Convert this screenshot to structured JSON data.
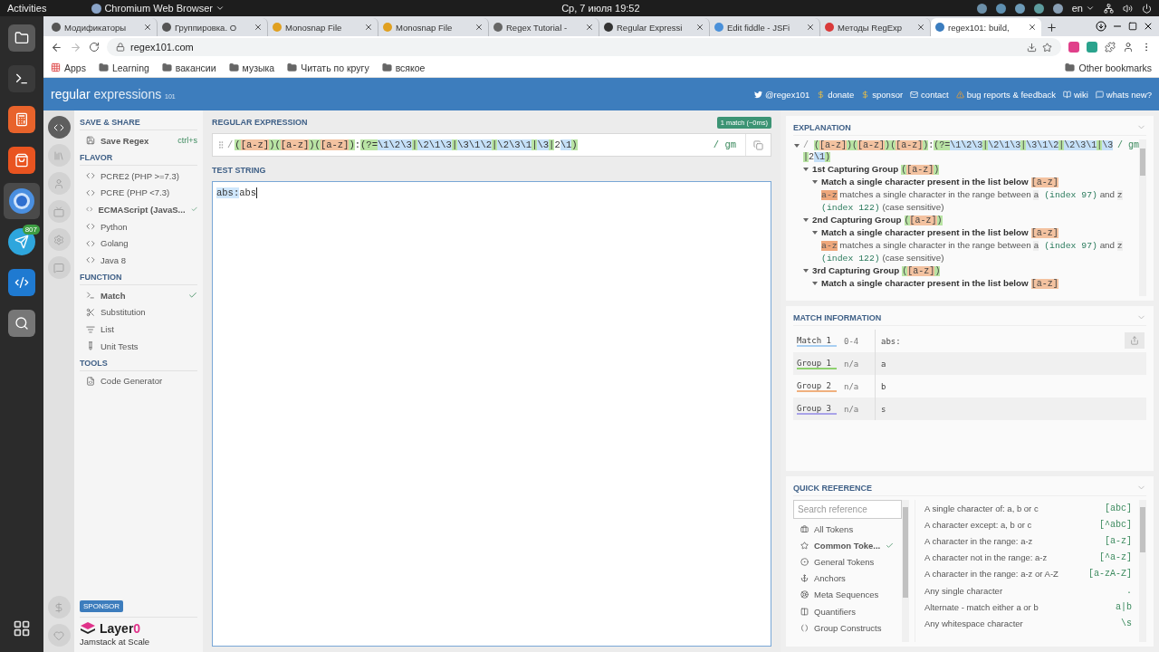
{
  "topbar": {
    "activities": "Activities",
    "app": "Chromium Web Browser",
    "clock": "Ср, 7 июля  19:52",
    "language": "en"
  },
  "dock": [
    {
      "kind": "files",
      "selected": false
    },
    {
      "kind": "terminal",
      "selected": false
    },
    {
      "kind": "calculator",
      "selected": false
    },
    {
      "kind": "store",
      "selected": false
    },
    {
      "kind": "chromium",
      "selected": true
    },
    {
      "kind": "telegram",
      "selected": false,
      "badge": "807"
    },
    {
      "kind": "vscode",
      "selected": false
    },
    {
      "kind": "screenshot",
      "selected": false
    }
  ],
  "browser": {
    "tabs": [
      {
        "title": "Модификаторы",
        "color": "#555555",
        "selected": false
      },
      {
        "title": "Группировка. О",
        "color": "#555555",
        "selected": false
      },
      {
        "title": "Monosnap File",
        "color": "#e0a020",
        "selected": false
      },
      {
        "title": "Monosnap File",
        "color": "#e0a020",
        "selected": false
      },
      {
        "title": "Regex Tutorial -",
        "color": "#666666",
        "selected": false
      },
      {
        "title": "Regular Expressi",
        "color": "#333333",
        "selected": false
      },
      {
        "title": "Edit fiddle - JSFi",
        "color": "#4a90d9",
        "selected": false
      },
      {
        "title": "Методы RegExp",
        "color": "#d93a3a",
        "selected": false
      },
      {
        "title": "regex101: build,",
        "color": "#3b7dbf",
        "selected": true
      }
    ],
    "url": "regex101.com",
    "bookmarks": [
      {
        "label": "Apps",
        "kind": "apps"
      },
      {
        "label": "Learning",
        "kind": "folder"
      },
      {
        "label": "вакансии",
        "kind": "folder"
      },
      {
        "label": "музыка",
        "kind": "folder"
      },
      {
        "label": "Читать по кругу",
        "kind": "folder"
      },
      {
        "label": "всякое",
        "kind": "folder"
      }
    ],
    "other_bookmarks": "Other bookmarks"
  },
  "site": {
    "logo": {
      "main": "regular",
      "sub": "expressions",
      "tag": "101"
    },
    "links": [
      {
        "label": "@regex101",
        "kind": "twitter"
      },
      {
        "label": "donate",
        "kind": "dollar"
      },
      {
        "label": "sponsor",
        "kind": "dollar"
      },
      {
        "label": "contact",
        "kind": "mail"
      },
      {
        "label": "bug reports & feedback",
        "kind": "bug"
      },
      {
        "label": "wiki",
        "kind": "wiki"
      },
      {
        "label": "whats new?",
        "kind": "chat"
      }
    ]
  },
  "rail": [
    {
      "kind": "code",
      "selected": true
    },
    {
      "kind": "library",
      "selected": false
    },
    {
      "kind": "user",
      "selected": false
    },
    {
      "kind": "video",
      "selected": false
    },
    {
      "kind": "settings",
      "selected": false
    },
    {
      "kind": "chat",
      "selected": false
    }
  ],
  "rail_bottom": [
    {
      "kind": "dollar"
    },
    {
      "kind": "heart"
    }
  ],
  "sidebar": {
    "sections": [
      {
        "title": "SAVE & SHARE",
        "items": [
          {
            "label": "Save Regex",
            "shortcut": "ctrl+s",
            "kind": "action"
          }
        ]
      },
      {
        "title": "FLAVOR",
        "items": [
          {
            "label": "PCRE2 (PHP >=7.3)",
            "kind": "option",
            "selected": false
          },
          {
            "label": "PCRE (PHP <7.3)",
            "kind": "option",
            "selected": false
          },
          {
            "label": "ECMAScript (JavaS...",
            "kind": "option",
            "selected": true
          },
          {
            "label": "Python",
            "kind": "option",
            "selected": false
          },
          {
            "label": "Golang",
            "kind": "option",
            "selected": false
          },
          {
            "label": "Java 8",
            "kind": "option",
            "selected": false
          }
        ]
      },
      {
        "title": "FUNCTION",
        "items": [
          {
            "label": "Match",
            "kind": "option",
            "selected": true
          },
          {
            "label": "Substitution",
            "kind": "option",
            "selected": false
          },
          {
            "label": "List",
            "kind": "option",
            "selected": false
          },
          {
            "label": "Unit Tests",
            "kind": "option",
            "selected": false
          }
        ]
      },
      {
        "title": "TOOLS",
        "items": [
          {
            "label": "Code Generator",
            "kind": "option",
            "selected": false
          }
        ]
      }
    ],
    "sponsor": {
      "badge": "SPONSOR",
      "brand": "Layer",
      "brand_accent": "0",
      "tagline": "Jamstack at Scale"
    }
  },
  "editor": {
    "regex_label": "REGULAR EXPRESSION",
    "status": "1 match (~0ms)",
    "delimiter": "/",
    "flags": "/ gm",
    "tokens": [
      {
        "text": "(",
        "kind": "group"
      },
      {
        "text": "[a-z]",
        "kind": "class"
      },
      {
        "text": ")",
        "kind": "group"
      },
      {
        "text": "(",
        "kind": "group"
      },
      {
        "text": "[a-z]",
        "kind": "class"
      },
      {
        "text": ")",
        "kind": "group"
      },
      {
        "text": "(",
        "kind": "group"
      },
      {
        "text": "[a-z]",
        "kind": "class"
      },
      {
        "text": ")",
        "kind": "group"
      },
      {
        "text": ":",
        "kind": "plain"
      },
      {
        "text": "(?=",
        "kind": "group"
      },
      {
        "text": "\\1\\2\\3",
        "kind": "backref"
      },
      {
        "text": "|",
        "kind": "group"
      },
      {
        "text": "\\2\\1\\3",
        "kind": "backref"
      },
      {
        "text": "|",
        "kind": "group"
      },
      {
        "text": "\\3\\1\\2",
        "kind": "backref"
      },
      {
        "text": "|",
        "kind": "group"
      },
      {
        "text": "\\2\\3\\1",
        "kind": "backref"
      },
      {
        "text": "|",
        "kind": "group"
      },
      {
        "text": "\\3",
        "kind": "backref"
      },
      {
        "text": "|",
        "kind": "group"
      },
      {
        "text": "2",
        "kind": "plain"
      },
      {
        "text": "\\1",
        "kind": "backref"
      },
      {
        "text": ")",
        "kind": "group"
      }
    ],
    "test_label": "TEST STRING",
    "test": [
      {
        "text": "abs:",
        "matched": true
      },
      {
        "text": "abs",
        "matched": false
      }
    ]
  },
  "explanation": {
    "title": "EXPLANATION",
    "tree": [
      {
        "delimiter": "/",
        "flags": "/ gm",
        "expanded": true,
        "tokens": [
          {
            "text": "(",
            "kind": "group"
          },
          {
            "text": "[a-z]",
            "kind": "class"
          },
          {
            "text": ")",
            "kind": "group"
          },
          {
            "text": "(",
            "kind": "group"
          },
          {
            "text": "[a-z]",
            "kind": "class"
          },
          {
            "text": ")",
            "kind": "group"
          },
          {
            "text": "(",
            "kind": "group"
          },
          {
            "text": "[a-z]",
            "kind": "class"
          },
          {
            "text": ")",
            "kind": "group"
          },
          {
            "text": ":",
            "kind": "plain"
          },
          {
            "text": "(?=",
            "kind": "group"
          },
          {
            "text": "\\1\\2\\3",
            "kind": "backref"
          },
          {
            "text": "|",
            "kind": "group"
          },
          {
            "text": "\\2\\1\\3",
            "kind": "backref"
          },
          {
            "text": "|",
            "kind": "group"
          },
          {
            "text": "\\3\\1\\2",
            "kind": "backref"
          },
          {
            "text": "|",
            "kind": "group"
          },
          {
            "text": "\\2\\3\\1",
            "kind": "backref"
          },
          {
            "text": "|",
            "kind": "group"
          },
          {
            "text": "\\3",
            "kind": "backref"
          },
          {
            "text": "|",
            "kind": "group"
          },
          {
            "text": "2",
            "kind": "plain"
          },
          {
            "text": "\\1",
            "kind": "backref"
          },
          {
            "text": ")",
            "kind": "group"
          }
        ],
        "children": [
          {
            "title": "1st Capturing Group",
            "expanded": true,
            "tokens": [
              {
                "text": "(",
                "kind": "group"
              },
              {
                "text": "[a-z]",
                "kind": "class"
              },
              {
                "text": ")",
                "kind": "group"
              }
            ],
            "children": [
              {
                "title": "Match a single character present in the list below",
                "expanded": true,
                "tokens": [
                  {
                    "text": "[a-z]",
                    "kind": "class"
                  }
                ],
                "detail": [
                  {
                    "text": "a-z",
                    "kind": "class"
                  },
                  {
                    "text": " matches a single character in the range between ",
                    "kind": "plain"
                  },
                  {
                    "text": "a",
                    "kind": "char"
                  },
                  {
                    "text": " (index 97)",
                    "kind": "code"
                  },
                  {
                    "text": " and ",
                    "kind": "plain"
                  },
                  {
                    "text": "z",
                    "kind": "char"
                  },
                  {
                    "text": " (index 122)",
                    "kind": "code"
                  },
                  {
                    "text": " (case sensitive)",
                    "kind": "plain"
                  }
                ]
              }
            ]
          },
          {
            "title": "2nd Capturing Group",
            "expanded": true,
            "tokens": [
              {
                "text": "(",
                "kind": "group"
              },
              {
                "text": "[a-z]",
                "kind": "class"
              },
              {
                "text": ")",
                "kind": "group"
              }
            ],
            "children": [
              {
                "title": "Match a single character present in the list below",
                "expanded": true,
                "tokens": [
                  {
                    "text": "[a-z]",
                    "kind": "class"
                  }
                ],
                "detail": [
                  {
                    "text": "a-z",
                    "kind": "class"
                  },
                  {
                    "text": " matches a single character in the range between ",
                    "kind": "plain"
                  },
                  {
                    "text": "a",
                    "kind": "char"
                  },
                  {
                    "text": " (index 97)",
                    "kind": "code"
                  },
                  {
                    "text": " and ",
                    "kind": "plain"
                  },
                  {
                    "text": "z",
                    "kind": "char"
                  },
                  {
                    "text": " (index 122)",
                    "kind": "code"
                  },
                  {
                    "text": " (case sensitive)",
                    "kind": "plain"
                  }
                ]
              }
            ]
          },
          {
            "title": "3rd Capturing Group",
            "expanded": true,
            "tokens": [
              {
                "text": "(",
                "kind": "group"
              },
              {
                "text": "[a-z]",
                "kind": "class"
              },
              {
                "text": ")",
                "kind": "group"
              }
            ],
            "children": [
              {
                "title": "Match a single character present in the list below",
                "expanded": true,
                "tokens": [
                  {
                    "text": "[a-z]",
                    "kind": "class"
                  }
                ]
              }
            ]
          }
        ]
      }
    ]
  },
  "match_info": {
    "title": "MATCH INFORMATION",
    "rows": [
      {
        "label": "Match 1",
        "range": "0-4",
        "value": "abs:",
        "color": "#a8cff2"
      },
      {
        "label": "Group 1",
        "range": "n/a",
        "value": "a",
        "color": "#8fd16f"
      },
      {
        "label": "Group 2",
        "range": "n/a",
        "value": "b",
        "color": "#f0b07e"
      },
      {
        "label": "Group 3",
        "range": "n/a",
        "value": "s",
        "color": "#a9a3e8"
      }
    ]
  },
  "quick_reference": {
    "title": "QUICK REFERENCE",
    "search_placeholder": "Search reference",
    "categories": [
      {
        "label": "All Tokens",
        "selected": false
      },
      {
        "label": "Common Toke...",
        "selected": true
      },
      {
        "label": "General Tokens",
        "selected": false
      },
      {
        "label": "Anchors",
        "selected": false
      },
      {
        "label": "Meta Sequences",
        "selected": false
      },
      {
        "label": "Quantifiers",
        "selected": false
      },
      {
        "label": "Group Constructs",
        "selected": false
      }
    ],
    "entries": [
      {
        "description": "A single character of: a, b or c",
        "token": "[abc]"
      },
      {
        "description": "A character except: a, b or c",
        "token": "[^abc]"
      },
      {
        "description": "A character in the range: a-z",
        "token": "[a-z]"
      },
      {
        "description": "A character not in the range: a-z",
        "token": "[^a-z]"
      },
      {
        "description": "A character in the range: a-z or A-Z",
        "token": "[a-zA-Z]"
      },
      {
        "description": "Any single character",
        "token": "."
      },
      {
        "description": "Alternate - match either a or b",
        "token": "a|b"
      },
      {
        "description": "Any whitespace character",
        "token": "\\s"
      }
    ]
  }
}
